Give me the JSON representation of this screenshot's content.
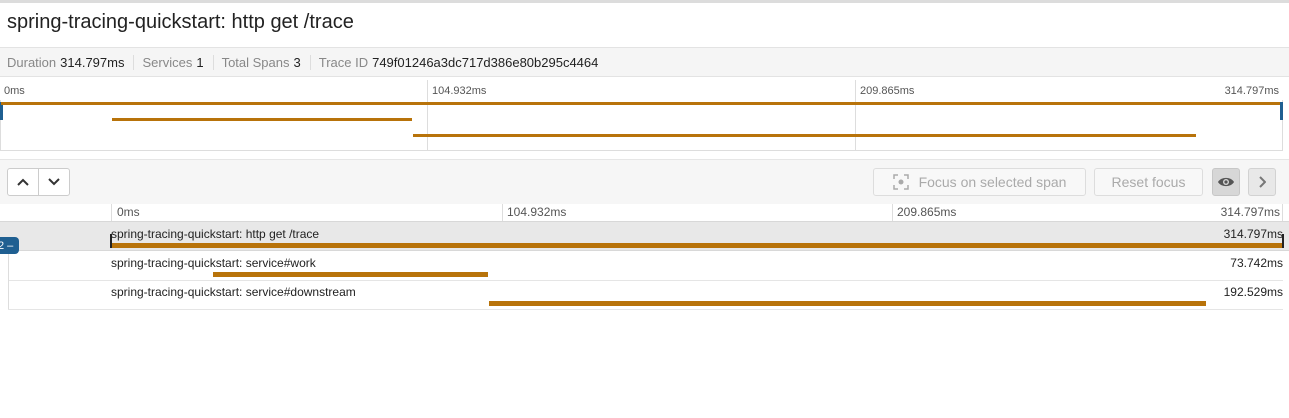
{
  "trace": {
    "title": "spring-tracing-quickstart: http get /trace",
    "duration_label": "Duration",
    "duration_value": "314.797ms",
    "services_label": "Services",
    "services_value": "1",
    "spans_label": "Total Spans",
    "spans_value": "3",
    "traceid_label": "Trace ID",
    "traceid_value": "749f01246a3dc717d386e80b295c4464"
  },
  "overview": {
    "ticks": [
      "0ms",
      "104.932ms",
      "209.865ms",
      "314.797ms"
    ]
  },
  "toolbar": {
    "focus_label": "Focus on selected span",
    "reset_label": "Reset focus",
    "icons": {
      "up": "chevron-up-icon",
      "down": "chevron-down-icon",
      "focus": "focus-target-icon",
      "eye": "eye-icon",
      "next": "chevron-right-icon"
    }
  },
  "timeline": {
    "ticks": [
      "0ms",
      "104.932ms",
      "209.865ms",
      "314.797ms"
    ],
    "total_ms": 314.797,
    "badge": "2 –"
  },
  "spans": [
    {
      "name": "spring-tracing-quickstart: http get /trace",
      "duration": "314.797ms",
      "start_ms": 0,
      "duration_ms": 314.797
    },
    {
      "name": "spring-tracing-quickstart: service#work",
      "duration": "73.742ms",
      "start_ms": 27.4,
      "duration_ms": 73.742
    },
    {
      "name": "spring-tracing-quickstart: service#downstream",
      "duration": "192.529ms",
      "start_ms": 101.5,
      "duration_ms": 192.529
    }
  ],
  "colors": {
    "span_bar": "#b8730a",
    "accent": "#1f5f91"
  }
}
